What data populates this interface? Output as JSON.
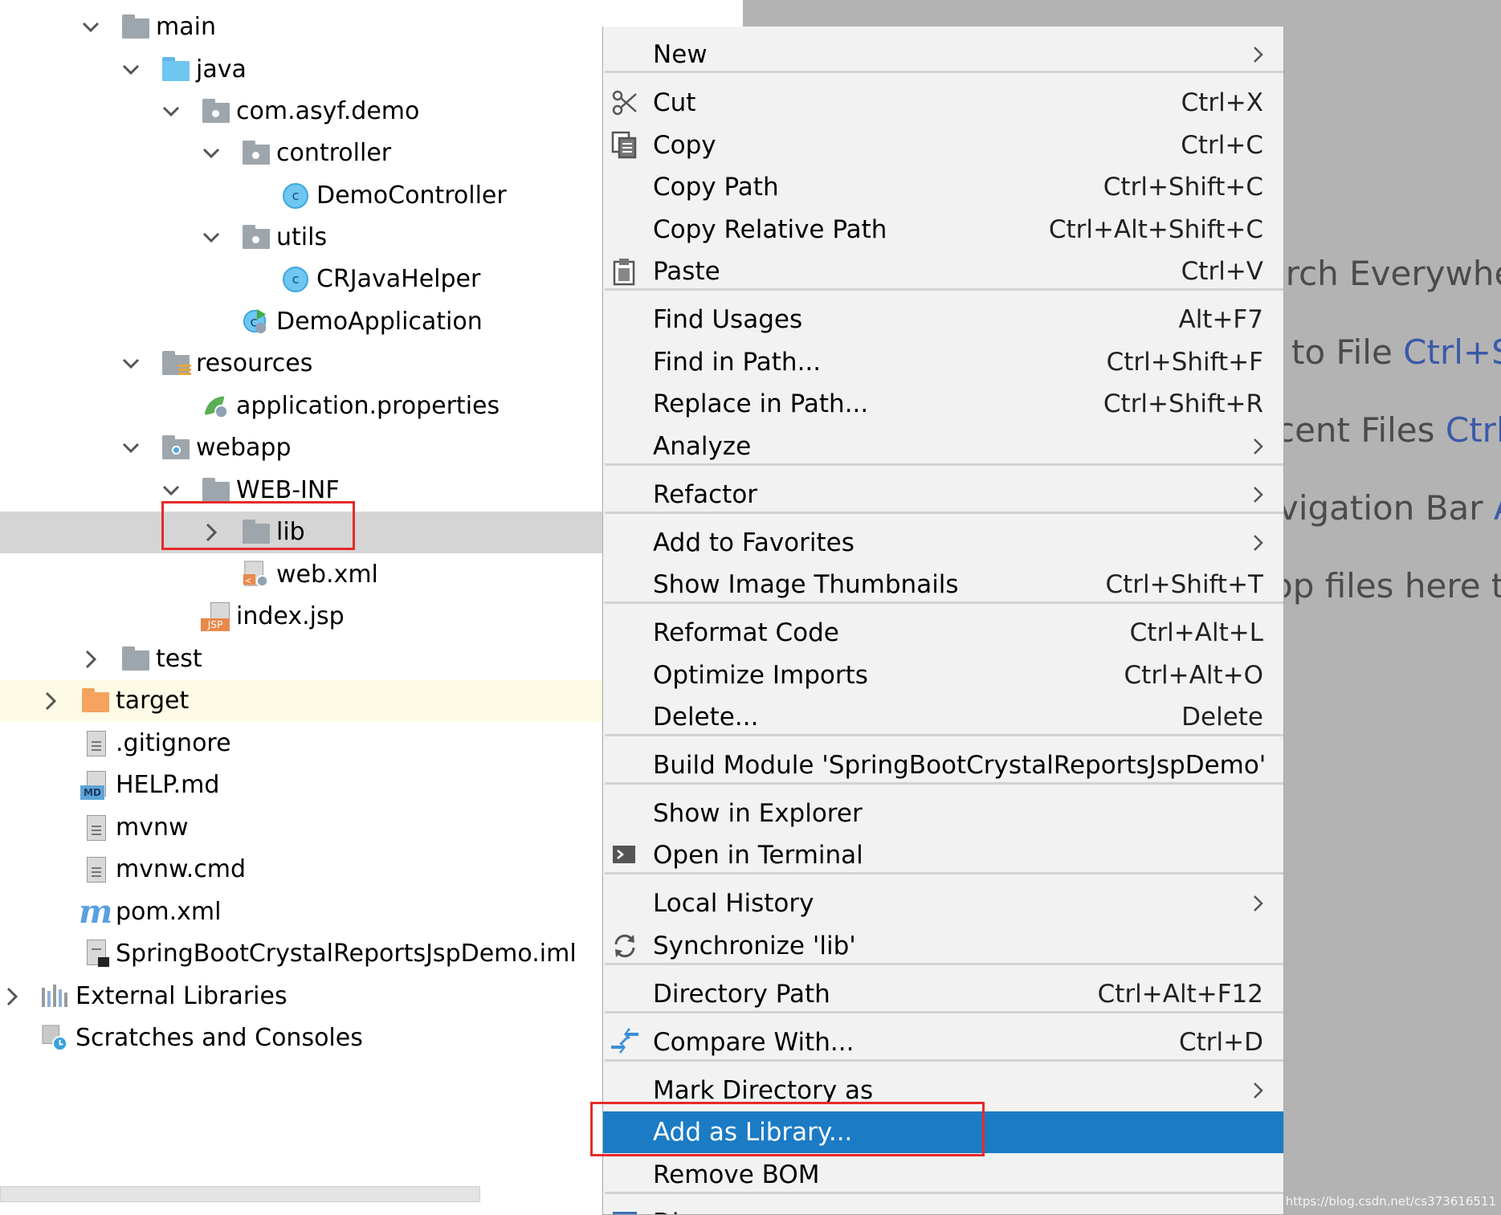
{
  "tree": {
    "rows": [
      {
        "label": "main"
      },
      {
        "label": "java"
      },
      {
        "label": "com.asyf.demo"
      },
      {
        "label": "controller"
      },
      {
        "label": "DemoController",
        "icon_letter": "c"
      },
      {
        "label": "utils"
      },
      {
        "label": "CRJavaHelper",
        "icon_letter": "c"
      },
      {
        "label": "DemoApplication"
      },
      {
        "label": "resources"
      },
      {
        "label": "application.properties"
      },
      {
        "label": "webapp"
      },
      {
        "label": "WEB-INF"
      },
      {
        "label": "lib"
      },
      {
        "label": "web.xml"
      },
      {
        "label": "index.jsp",
        "icon_text": "JSP"
      },
      {
        "label": "test"
      },
      {
        "label": "target"
      },
      {
        "label": ".gitignore"
      },
      {
        "label": "HELP.md",
        "icon_text": "MD"
      },
      {
        "label": "mvnw"
      },
      {
        "label": "mvnw.cmd"
      },
      {
        "label": "pom.xml",
        "icon_text": "m"
      },
      {
        "label": "SpringBootCrystalReportsJspDemo.iml"
      },
      {
        "label": "External Libraries"
      },
      {
        "label": "Scratches and Consoles"
      }
    ]
  },
  "editor": {
    "hints": [
      {
        "text": "arch Everywhe",
        "key": ""
      },
      {
        "text": "to File ",
        "key": "Ctrl+Sh"
      },
      {
        "text": "cent Files ",
        "key": "Ctrl+"
      },
      {
        "text": "vigation Bar ",
        "key": "A"
      },
      {
        "text": "op files here to",
        "key": ""
      }
    ],
    "watermark": "https://blog.csdn.net/cs373616511"
  },
  "menu": {
    "items": [
      {
        "label": "New",
        "shortcut": "",
        "submenu": true
      },
      {
        "label": "Cut",
        "shortcut": "Ctrl+X",
        "icon": "scissors-icon"
      },
      {
        "label": "Copy",
        "shortcut": "Ctrl+C",
        "icon": "copy-icon"
      },
      {
        "label": "Copy Path",
        "shortcut": "Ctrl+Shift+C"
      },
      {
        "label": "Copy Relative Path",
        "shortcut": "Ctrl+Alt+Shift+C"
      },
      {
        "label": "Paste",
        "shortcut": "Ctrl+V",
        "icon": "clipboard-icon"
      },
      {
        "label": "Find Usages",
        "shortcut": "Alt+F7"
      },
      {
        "label": "Find in Path...",
        "shortcut": "Ctrl+Shift+F"
      },
      {
        "label": "Replace in Path...",
        "shortcut": "Ctrl+Shift+R"
      },
      {
        "label": "Analyze",
        "shortcut": "",
        "submenu": true
      },
      {
        "label": "Refactor",
        "shortcut": "",
        "submenu": true
      },
      {
        "label": "Add to Favorites",
        "shortcut": "",
        "submenu": true
      },
      {
        "label": "Show Image Thumbnails",
        "shortcut": "Ctrl+Shift+T"
      },
      {
        "label": "Reformat Code",
        "shortcut": "Ctrl+Alt+L"
      },
      {
        "label": "Optimize Imports",
        "shortcut": "Ctrl+Alt+O"
      },
      {
        "label": "Delete...",
        "shortcut": "Delete"
      },
      {
        "label": "Build Module 'SpringBootCrystalReportsJspDemo'",
        "shortcut": ""
      },
      {
        "label": "Show in Explorer",
        "shortcut": ""
      },
      {
        "label": "Open in Terminal",
        "shortcut": "",
        "icon": "terminal-icon"
      },
      {
        "label": "Local History",
        "shortcut": "",
        "submenu": true
      },
      {
        "label": "Synchronize 'lib'",
        "shortcut": "",
        "icon": "sync-icon"
      },
      {
        "label": "Directory Path",
        "shortcut": "Ctrl+Alt+F12"
      },
      {
        "label": "Compare With...",
        "shortcut": "Ctrl+D",
        "icon": "compare-icon"
      },
      {
        "label": "Mark Directory as",
        "shortcut": "",
        "submenu": true
      },
      {
        "label": "Add as Library...",
        "shortcut": "",
        "highlighted": true
      },
      {
        "label": "Remove BOM",
        "shortcut": ""
      },
      {
        "label": "Diagrams",
        "shortcut": "",
        "submenu": true
      }
    ]
  },
  "colors": {
    "highlight": "#1b7bc4",
    "annotation_red": "#e52b2b",
    "selected_row": "#d5d5d5",
    "excluded_row": "#fdfbe6"
  }
}
